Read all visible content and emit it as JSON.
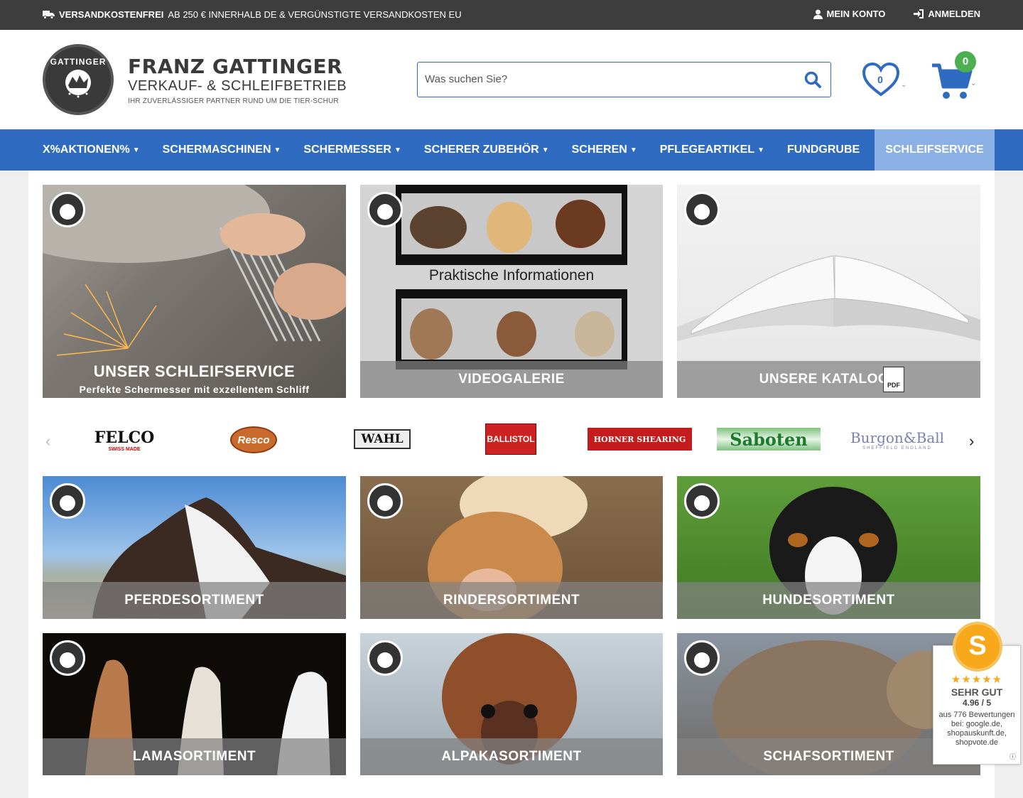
{
  "topbar": {
    "promo_bold": "VERSANDKOSTENFREI",
    "promo_rest": "AB 250 € INNERHALB DE & VERGÜNSTIGTE VERSANDKOSTEN EU",
    "account_label": "MEIN KONTO",
    "login_label": "ANMELDEN"
  },
  "logo": {
    "name": "FRANZ GATTINGER",
    "sub": "VERKAUF- & SCHLEIFBETRIEB",
    "tagline": "IHR ZUVERLÄSSIGER PARTNER RUND UM DIE TIER-SCHUR",
    "seal_text": "GATTINGER"
  },
  "search": {
    "placeholder": "Was suchen Sie?"
  },
  "wishlist": {
    "count": "0"
  },
  "cart": {
    "count": "0"
  },
  "nav": {
    "items": [
      {
        "label": "X%AKTIONEN%"
      },
      {
        "label": "SCHERMASCHINEN"
      },
      {
        "label": "SCHERMESSER"
      },
      {
        "label": "SCHERER ZUBEHÖR"
      },
      {
        "label": "SCHEREN"
      },
      {
        "label": "PFLEGEARTIKEL"
      },
      {
        "label": "FUNDGRUBE"
      }
    ],
    "service": "SCHLEIFSERVICE"
  },
  "promo_tiles": [
    {
      "title": "UNSER SCHLEIFSERVICE",
      "subtitle": "Perfekte Schermesser mit exzellentem Schliff"
    },
    {
      "title": "VIDEOGALERIE",
      "banner_text": "Praktische Informationen"
    },
    {
      "title": "UNSERE KATALOGE",
      "icon_text": "PDF"
    }
  ],
  "brands": [
    "FELCO",
    "Resco",
    "WAHL",
    "BALLISTOL",
    "HORNER SHEARING",
    "Saboten",
    "Burgon&Ball"
  ],
  "brand_sub": {
    "felco": "SWISS MADE",
    "burgon": "SHEFFIELD ENGLAND"
  },
  "category_tiles": [
    {
      "title": "PFERDESORTIMENT"
    },
    {
      "title": "RINDERSORTIMENT"
    },
    {
      "title": "HUNDESORTIMENT"
    },
    {
      "title": "LAMASORTIMENT"
    },
    {
      "title": "ALPAKASORTIMENT"
    },
    {
      "title": "SCHAFSORTIMENT"
    }
  ],
  "review": {
    "medal": "S",
    "stars": "★★★★★",
    "label": "SEHR GUT",
    "score": "4.96 / 5",
    "source": "aus 776 Bewertungen bei: google.de, shopauskunft.de, shopvote.de",
    "info": "ⓘ"
  },
  "colors": {
    "accent": "#2f6bc0",
    "topbar": "#3d3d3d",
    "badge": "#4caf50",
    "service": "#8bb0e6"
  }
}
